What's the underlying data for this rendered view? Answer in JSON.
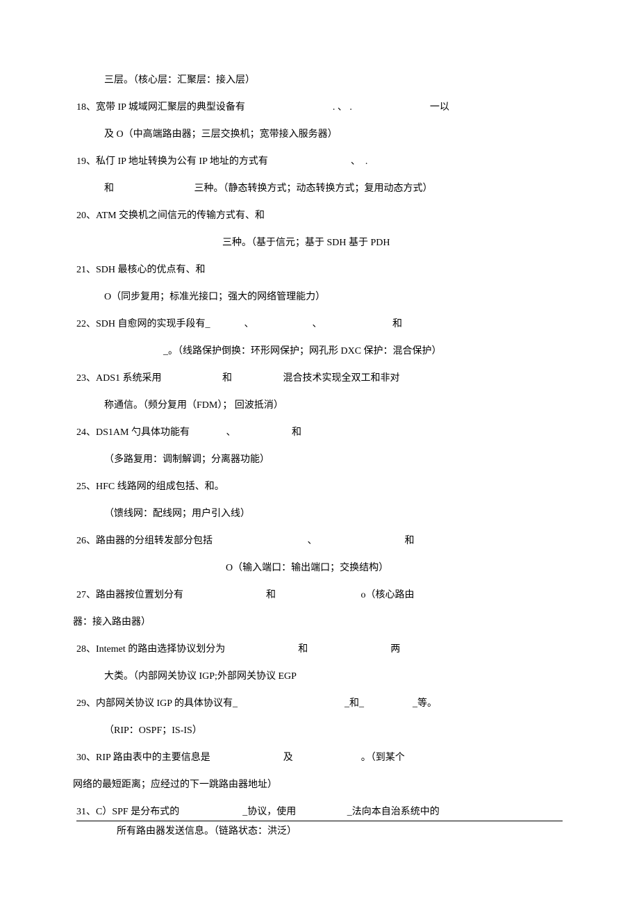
{
  "lines": {
    "l01": "三层。（核心层：汇聚层：接入层）",
    "l02": "18、宽带 IP 城域网汇聚层的典型设备有                                    . 、 .                                一以",
    "l03": "及 O（中高端路由器；三层交换机；宽带接入服务器）",
    "l04": "19、私仃 IP 地址转换为公有 IP 地址的方式有                                  、  .",
    "l05": "和                                 三种。（静态转换方式；动态转换方式；复用动态方式）",
    "l06": "20、ATM 交换机之间信元的传输方式有、和",
    "l07": "三种。（基于信元；基于 SDH 基于 PDH",
    "l08": "21、SDH 最核心的优点有、和",
    "l09": "O（同步复用；标准光接口；强大的网络管理能力）",
    "l10": "22、SDH 自愈网的实现手段有_              、                        、                             和",
    "l11": "_。（线路保护倒换：环形网保护；网孔形 DXC 保护：混合保护）",
    "l12": "23、ADS1 系统采用                         和                     混合技术实现全双工和非对",
    "l13": "称通信。（频分复用（FDM）； 回波抵消）",
    "l14": "24、DS1AM 勺具体功能有               、                       和",
    "l15": "（多路复用：调制解调；分离器功能）",
    "l16": "25、HFC 线路网的组成包括、和。",
    "l17": "（馈线网：配线网；用户引入线）",
    "l18": "26、路由器的分组转发部分包括                                       、                                    和",
    "l19": "O（输入端口：输出端口；交换结构）",
    "l20": "27、路由器按位置划分有                                  和                                   o（核心路由",
    "l21": "器：接入路由器）",
    "l22": "28、Intemet 的路由选择协议划分为                              和                                  两",
    "l23": "大类。（内部网关协议 IGP;外部网关协议 EGP",
    "l24": "29、内部网关协议 IGP 的具体协议有_                                            _和_                    _等。",
    "l25": "（RIP：OSPF；IS-IS）",
    "l26": "30、RIP 路由表中的主要信息是                              及                            。（到某个",
    "l27": "网络的最短距离；应经过的下一跳路由器地址）",
    "l28": "31、C）SPF 是分布式的                          _协议，使用                     _法向本自治系统中的",
    "l29": "所有路由器发送信息。（链路状态：洪泛）"
  }
}
